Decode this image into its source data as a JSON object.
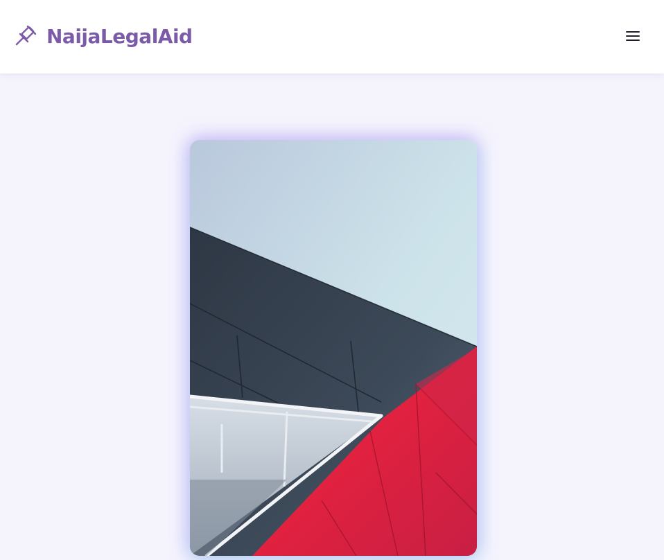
{
  "header": {
    "brand_name": "NaijaLegalAid",
    "brand_icon": "gavel-icon",
    "menu_icon": "hamburger-menu-icon"
  },
  "hero": {
    "image": "abstract-architecture-red-panels-image"
  },
  "colors": {
    "brand": "#7b5ba8",
    "page_background": "#f5f4fd",
    "header_background": "#ffffff",
    "panel_red": "#e0213f",
    "facade_dark": "#3a4452",
    "sky": "#c6dde6"
  }
}
